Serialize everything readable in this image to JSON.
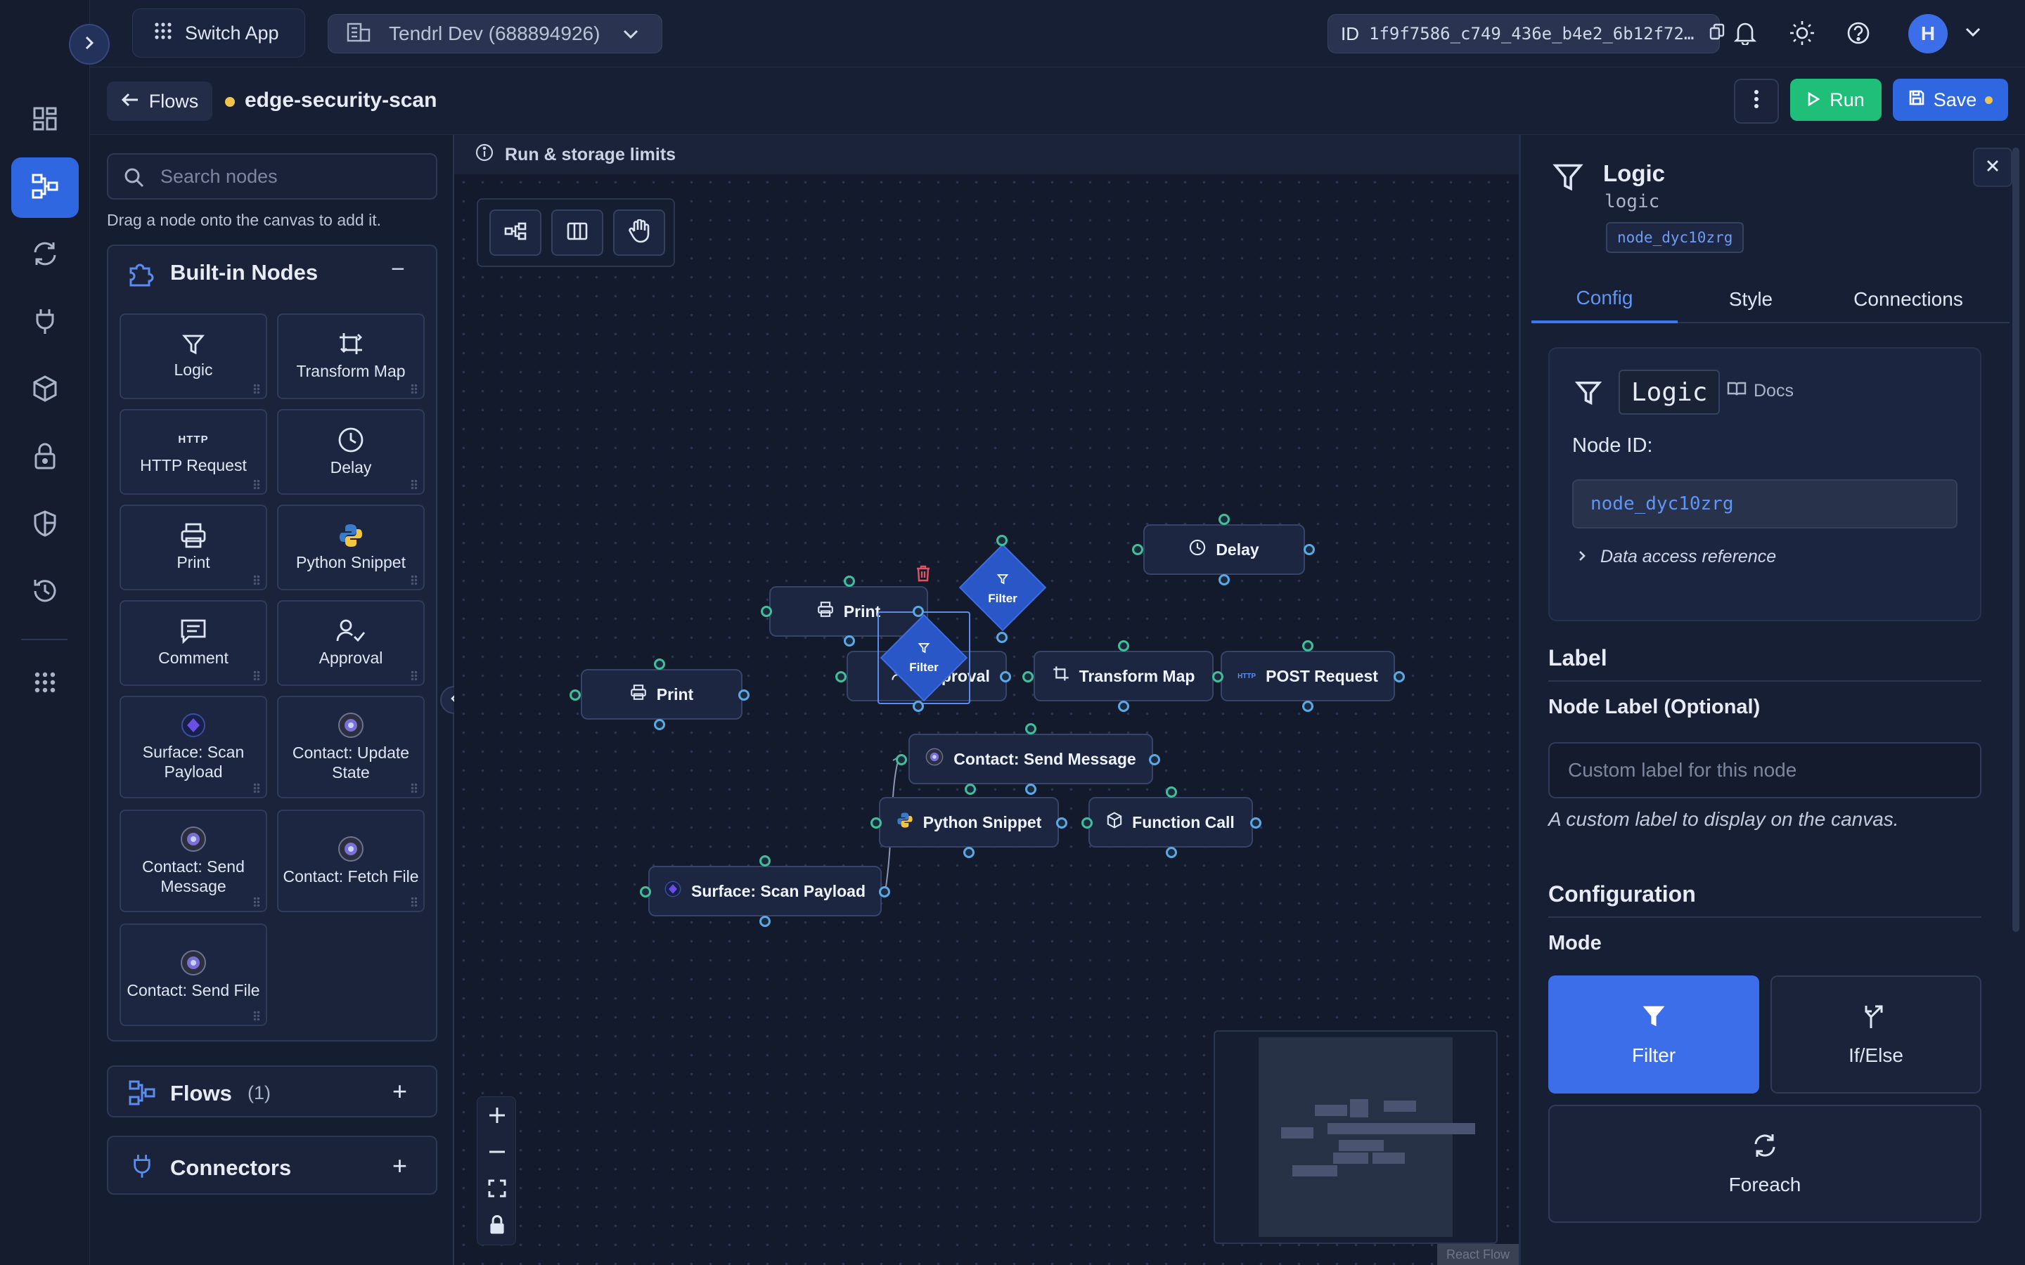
{
  "topbar": {
    "switch_app": "Switch App",
    "workspace": "Tendrl Dev (688894926)",
    "id_label": "ID",
    "id_value": "1f9f7586_c749_436e_b4e2_6b12f72…",
    "avatar_initial": "H"
  },
  "rail": {
    "icons": [
      "dashboard-icon",
      "flows-icon",
      "sync-icon",
      "plug-icon",
      "cube-icon",
      "lock-icon",
      "shield-icon",
      "history-icon",
      "apps-grid-icon"
    ],
    "active_index": 1
  },
  "flow_header": {
    "back_label": "Flows",
    "flow_name": "edge-security-scan",
    "run_label": "Run",
    "save_label": "Save",
    "unsaved_dot_color": "#f2c44a"
  },
  "left_panel": {
    "search_placeholder": "Search nodes",
    "drag_hint": "Drag a node onto the canvas to add it.",
    "builtin_title": "Built-in Nodes",
    "builtin_toggle": "−",
    "tiles": [
      {
        "label": "Logic",
        "icon": "filter-icon"
      },
      {
        "label": "Transform Map",
        "icon": "transform-icon"
      },
      {
        "label": "HTTP Request",
        "icon": "http-icon",
        "icon_text": "HTTP"
      },
      {
        "label": "Delay",
        "icon": "clock-icon"
      },
      {
        "label": "Print",
        "icon": "printer-icon"
      },
      {
        "label": "Python Snippet",
        "icon": "python-icon"
      },
      {
        "label": "Comment",
        "icon": "comment-icon"
      },
      {
        "label": "Approval",
        "icon": "approval-icon"
      },
      {
        "label": "Surface: Scan Payload",
        "icon": "surface-icon"
      },
      {
        "label": "Contact: Update State",
        "icon": "contact-icon"
      },
      {
        "label": "Contact: Send Message",
        "icon": "contact-icon"
      },
      {
        "label": "Contact: Fetch File",
        "icon": "contact-icon"
      },
      {
        "label": "Contact: Send File",
        "icon": "contact-icon"
      }
    ],
    "flows_title": "Flows",
    "flows_count": "(1)",
    "connectors_title": "Connectors",
    "add": "+"
  },
  "canvas": {
    "limits_text": "Run & storage limits",
    "nodes": {
      "print_a": "Print",
      "print_b": "Print",
      "approval": "Approval",
      "filter_a": "Filter",
      "filter_b": "Filter",
      "delay": "Delay",
      "transform": "Transform Map",
      "post": "POST Request",
      "send_msg": "Contact: Send Message",
      "python": "Python Snippet",
      "function": "Function Call",
      "surface": "Surface: Scan Payload"
    },
    "http_badge": "HTTP",
    "react_flow": "React Flow"
  },
  "right_panel": {
    "title": "Logic",
    "subtitle": "logic",
    "node_chip": "node_dyc10zrg",
    "tabs": [
      "Config",
      "Style",
      "Connections"
    ],
    "active_tab": 0,
    "card_title": "Logic",
    "docs": "Docs",
    "node_id_label": "Node ID:",
    "node_id_value": "node_dyc10zrg",
    "data_access": "Data access reference",
    "label_section": "Label",
    "node_label_title": "Node Label (Optional)",
    "node_label_placeholder": "Custom label for this node",
    "node_label_help": "A custom label to display on the canvas.",
    "config_section": "Configuration",
    "mode_label": "Mode",
    "modes": [
      "Filter",
      "If/Else",
      "Foreach"
    ],
    "selected_mode": 0
  },
  "colors": {
    "accent": "#2f67e0",
    "run_green": "#1fbf7a",
    "save_blue": "#2f67e0",
    "node_border": "#364468",
    "filter_diamond": "#2a57c8",
    "delete_red": "#e05260"
  }
}
